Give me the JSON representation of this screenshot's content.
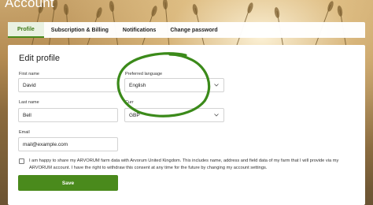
{
  "page": {
    "title": "Account"
  },
  "tabs": [
    {
      "label": "Profile",
      "active": true
    },
    {
      "label": "Subscription & Billing",
      "active": false
    },
    {
      "label": "Notifications",
      "active": false
    },
    {
      "label": "Change password",
      "active": false
    }
  ],
  "form": {
    "title": "Edit profile",
    "first_name": {
      "label": "First name",
      "value": "David"
    },
    "preferred_language": {
      "label": "Preferred language",
      "value": "English"
    },
    "last_name": {
      "label": "Last name",
      "value": "Bell"
    },
    "currency": {
      "label": "Curr",
      "value": "GBP"
    },
    "email": {
      "label": "Email",
      "value": "mail@example.com"
    },
    "consent": {
      "checked": false,
      "text": "I am happy to share my ARVORUM farm data with Arvorum United Kingdom. This includes name, address and field data of my farm that I will provide via my ARVORUM account. I have the right to withdraw this consent at any time for the future by changing my account settings."
    },
    "save_label": "Save"
  },
  "colors": {
    "accent": "#4a8a1c",
    "annotation_circle": "#3b8a1a",
    "tab_active_bg": "#e9f1e1"
  },
  "icons": {
    "select_chevron": "chevron-down-icon",
    "highlight": "hand-drawn-circle"
  }
}
